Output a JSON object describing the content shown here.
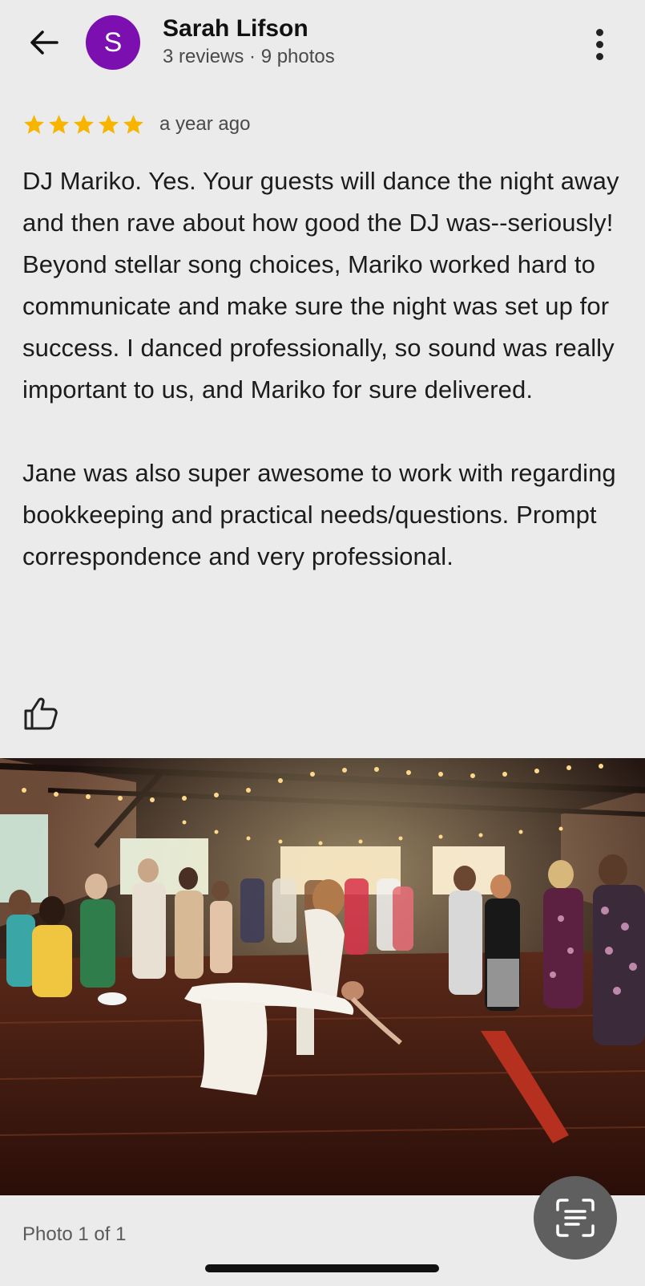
{
  "header": {
    "avatar_letter": "S",
    "avatar_color": "#7b0fb0",
    "name": "Sarah Lifson",
    "meta": "3 reviews · 9 photos"
  },
  "review": {
    "rating": 5,
    "star_color": "#f7b500",
    "time_ago": "a year ago",
    "paragraphs": [
      "DJ Mariko. Yes. Your guests will dance the night away and then rave about how good the DJ was--seriously! Beyond stellar song choices, Mariko worked hard to communicate and make sure the night was set up for success. I danced professionally, so sound was really important to us, and Mariko for sure delivered.",
      "Jane was also super awesome to work with regarding bookkeeping and practical needs/questions. Prompt correspondence and very professional."
    ]
  },
  "photo": {
    "counter": "Photo 1 of 1"
  },
  "icons": {
    "back": "back-arrow-icon",
    "more": "more-vert-icon",
    "like": "thumbs-up-icon",
    "lens": "lens-icon"
  }
}
